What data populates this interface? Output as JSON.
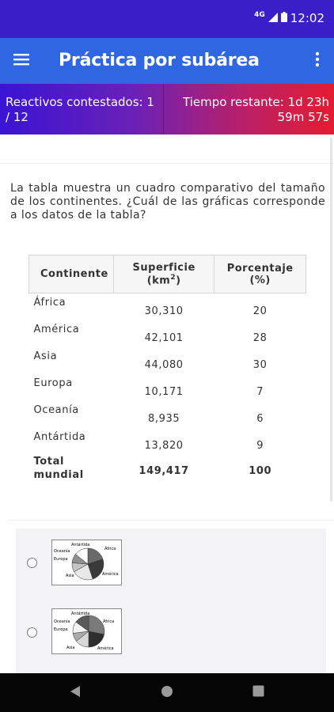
{
  "status_bar": {
    "network": "4G",
    "time": "12:02"
  },
  "app_bar": {
    "title": "Práctica por subárea"
  },
  "info": {
    "answered": "Reactivos contestados: 1 / 12",
    "timer": "Tiempo restante: 1d 23h 59m 57s"
  },
  "question": {
    "text": "La tabla muestra un cuadro comparativo del tamaño de los continentes. ¿Cuál de las gráficas corresponde a los datos de la tabla?"
  },
  "table": {
    "headers": {
      "continent": "Continente",
      "area": "Superficie",
      "area_unit_prefix": "(km",
      "area_unit_exp": "2",
      "area_unit_suffix": ")",
      "percent": "Porcentaje",
      "percent_unit": "(%)"
    },
    "rows": [
      {
        "name": "África",
        "area": "30,310",
        "percent": "20"
      },
      {
        "name": "América",
        "area": "42,101",
        "percent": "28"
      },
      {
        "name": "Asia",
        "area": "44,080",
        "percent": "30"
      },
      {
        "name": "Europa",
        "area": "10,171",
        "percent": "7"
      },
      {
        "name": "Oceanía",
        "area": "8,935",
        "percent": "6"
      },
      {
        "name": "Antártida",
        "area": "13,820",
        "percent": "9"
      }
    ],
    "total": {
      "name_line1": "Total",
      "name_line2": "mundial",
      "area": "149,417",
      "percent": "100"
    }
  },
  "options": [
    {
      "labels": {
        "antartida": "Antártida",
        "oceania": "Oceanía",
        "europa": "Europa",
        "africa": "África",
        "asia": "Asia",
        "america": "América"
      }
    },
    {
      "labels": {
        "antartida": "Antártida",
        "oceania": "Oceanía",
        "europa": "Europa",
        "africa": "África",
        "asia": "Asia",
        "america": "América"
      }
    }
  ],
  "colors": {
    "status_bar": "#3a1ec8",
    "app_bar": "#2f66e2",
    "info_gradient_start": "#3a14d4",
    "info_gradient_end": "#e41c30",
    "nav_bar": "#050505"
  },
  "icons": {
    "menu": "hamburger-icon",
    "overflow": "more-vert-icon",
    "back": "triangle-back-icon",
    "home": "circle-home-icon",
    "recents": "square-recents-icon"
  }
}
